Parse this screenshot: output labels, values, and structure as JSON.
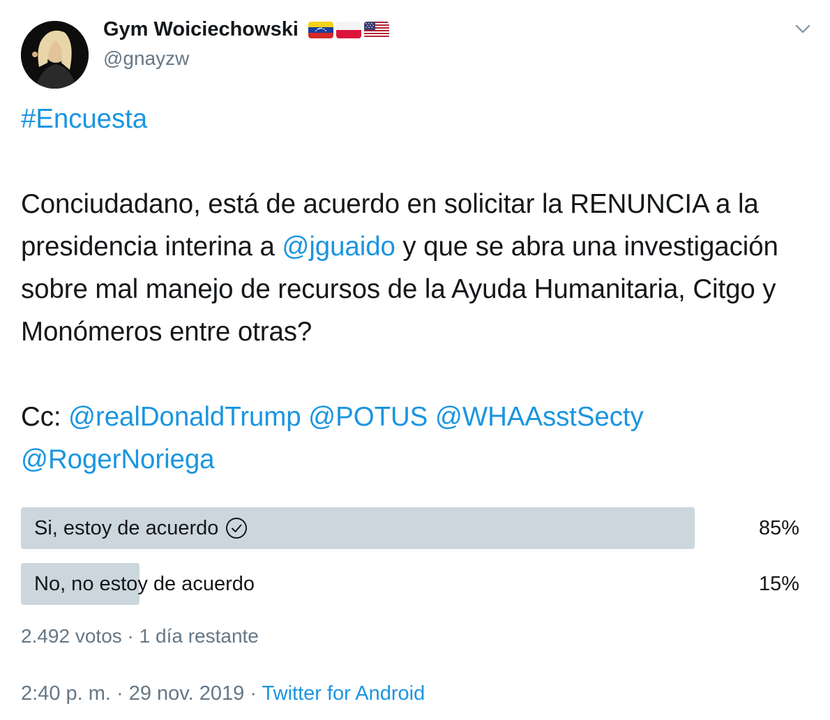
{
  "user": {
    "display_name": "Gym Woiciechowski",
    "handle": "@gnayzw",
    "flags": [
      "venezuela-flag-icon",
      "poland-flag-icon",
      "usa-flag-icon"
    ]
  },
  "tweet": {
    "hashtag": "#Encuesta",
    "body_part1": "Conciudadano, está de acuerdo en solicitar la RENUNCIA a la presidencia interina a ",
    "mention_guaido": "@jguaido",
    "body_part2": " y que se abra una investigación sobre mal manejo de recursos de la Ayuda Humanitaria, Citgo y Monómeros entre otras?",
    "cc_label": "Cc: ",
    "mentions": [
      "@realDonaldTrump",
      "@POTUS",
      "@WHAAsstSecty",
      "@RogerNoriega"
    ]
  },
  "poll": {
    "options": [
      {
        "label": "Si, estoy de acuerdo",
        "percent_label": "85%",
        "percent": 85,
        "selected": true
      },
      {
        "label": "No, no estoy de acuerdo",
        "percent_label": "15%",
        "percent": 15,
        "selected": false
      }
    ],
    "votes_text": "2.492 votos · 1 día restante"
  },
  "footer": {
    "time": "2:40 p. m. · 29 nov. 2019 · ",
    "source": "Twitter for Android"
  },
  "colors": {
    "link": "#1b95e0",
    "bar": "#ccd6dd",
    "muted": "#657786"
  }
}
